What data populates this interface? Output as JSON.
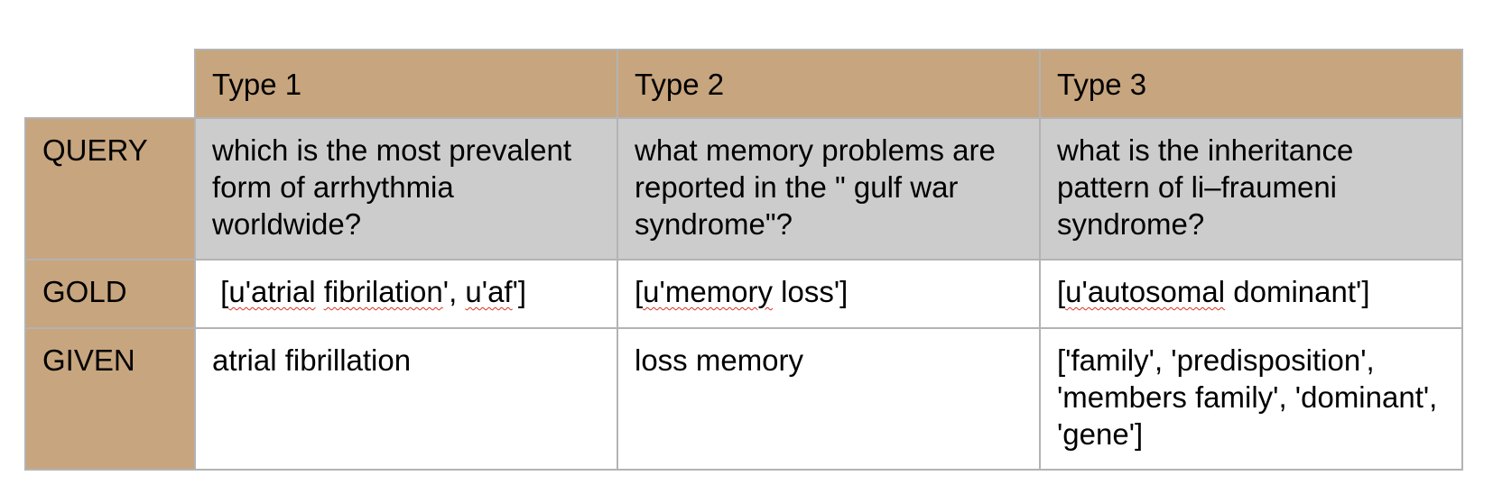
{
  "table": {
    "headers": [
      "Type 1",
      "Type 2",
      "Type 3"
    ],
    "rows": [
      {
        "label": "QUERY",
        "cells": [
          "which is the most prevalent form of arrhythmia worldwide?",
          "what memory problems are reported in the \" gulf war syndrome\"?",
          "what is the inheritance pattern of li–fraumeni syndrome?"
        ]
      },
      {
        "label": "GOLD",
        "cells": [
          [
            {
              "t": " [",
              "s": false
            },
            {
              "t": "u'atrial",
              "s": true
            },
            {
              "t": " ",
              "s": false
            },
            {
              "t": "fibrilation",
              "s": true
            },
            {
              "t": "', ",
              "s": false
            },
            {
              "t": "u'af",
              "s": true
            },
            {
              "t": "']",
              "s": false
            }
          ],
          [
            {
              "t": "[",
              "s": false
            },
            {
              "t": "u'memory",
              "s": true
            },
            {
              "t": " loss']",
              "s": false
            }
          ],
          [
            {
              "t": "[",
              "s": false
            },
            {
              "t": "u'autosomal",
              "s": true
            },
            {
              "t": " dominant']",
              "s": false
            }
          ]
        ]
      },
      {
        "label": "GIVEN",
        "cells": [
          "atrial fibrillation",
          "loss memory",
          "['family', 'predisposition', 'members family', 'dominant', 'gene']"
        ]
      }
    ]
  }
}
